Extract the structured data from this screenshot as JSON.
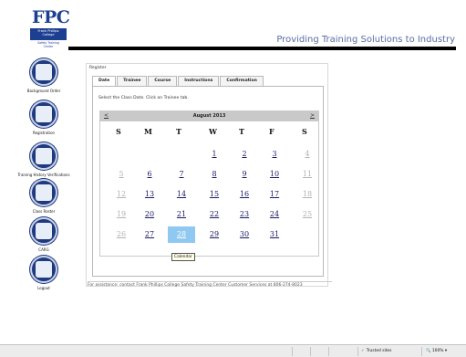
{
  "header": {
    "logo_text": "FPC",
    "logo_line1": "Frank Phillips",
    "logo_line2": "College",
    "logo_sub1": "Safety Training",
    "logo_sub2": "Center",
    "tagline": "Providing Training Solutions to Industry"
  },
  "nav": {
    "items": [
      {
        "label": "Background Order",
        "icon": "background-order-icon"
      },
      {
        "label": "Registration",
        "icon": "registration-icon"
      },
      {
        "label": "Training History Verifications",
        "icon": "training-history-icon"
      },
      {
        "label": "Class Roster",
        "icon": "class-roster-icon"
      },
      {
        "label": "CARG",
        "icon": "carg-icon"
      },
      {
        "label": "Logout",
        "icon": "logout-icon"
      }
    ]
  },
  "panel": {
    "title": "Register",
    "tabs": [
      "Date",
      "Trainee",
      "Course",
      "Instructions",
      "Confirmation"
    ],
    "active_tab": "Date",
    "instructions": "Select the Class Date. Click on Trainee tab."
  },
  "calendar": {
    "prev_label": "<",
    "next_label": ">",
    "month_label": "August 2013",
    "days_of_week": [
      "S",
      "M",
      "T",
      "W",
      "T",
      "F",
      "S"
    ],
    "selected_day": "28",
    "weeks": [
      [
        {
          "d": "",
          "s": ""
        },
        {
          "d": "",
          "s": ""
        },
        {
          "d": "",
          "s": ""
        },
        {
          "d": "1",
          "s": "cur"
        },
        {
          "d": "2",
          "s": "cur"
        },
        {
          "d": "3",
          "s": "cur"
        },
        {
          "d": "4",
          "s": "other"
        }
      ],
      [
        {
          "d": "5",
          "s": "other"
        },
        {
          "d": "6",
          "s": "cur"
        },
        {
          "d": "7",
          "s": "cur"
        },
        {
          "d": "8",
          "s": "cur"
        },
        {
          "d": "9",
          "s": "cur"
        },
        {
          "d": "10",
          "s": "cur"
        },
        {
          "d": "11",
          "s": "other"
        }
      ],
      [
        {
          "d": "12",
          "s": "other"
        },
        {
          "d": "13",
          "s": "cur"
        },
        {
          "d": "14",
          "s": "cur"
        },
        {
          "d": "15",
          "s": "cur"
        },
        {
          "d": "16",
          "s": "cur"
        },
        {
          "d": "17",
          "s": "cur"
        },
        {
          "d": "18",
          "s": "other"
        }
      ],
      [
        {
          "d": "19",
          "s": "other"
        },
        {
          "d": "20",
          "s": "cur"
        },
        {
          "d": "21",
          "s": "cur"
        },
        {
          "d": "22",
          "s": "cur"
        },
        {
          "d": "23",
          "s": "cur"
        },
        {
          "d": "24",
          "s": "cur"
        },
        {
          "d": "25",
          "s": "other"
        }
      ],
      [
        {
          "d": "26",
          "s": "other"
        },
        {
          "d": "27",
          "s": "cur"
        },
        {
          "d": "28",
          "s": "cur"
        },
        {
          "d": "29",
          "s": "cur"
        },
        {
          "d": "30",
          "s": "cur"
        },
        {
          "d": "31",
          "s": "cur"
        },
        {
          "d": "",
          "s": ""
        }
      ]
    ],
    "tooltip": "Calendar"
  },
  "footer_note": "For assistance: contact Frank Phillips College Safety Training Center Customer Services at 806-274-8023",
  "statusbar": {
    "trusted_label": "Trusted sites",
    "zoom_label": "100%"
  },
  "colors": {
    "brand_blue": "#1d3f91",
    "brand_gold": "#f3b224",
    "selected_day": "#8fc8f0"
  }
}
